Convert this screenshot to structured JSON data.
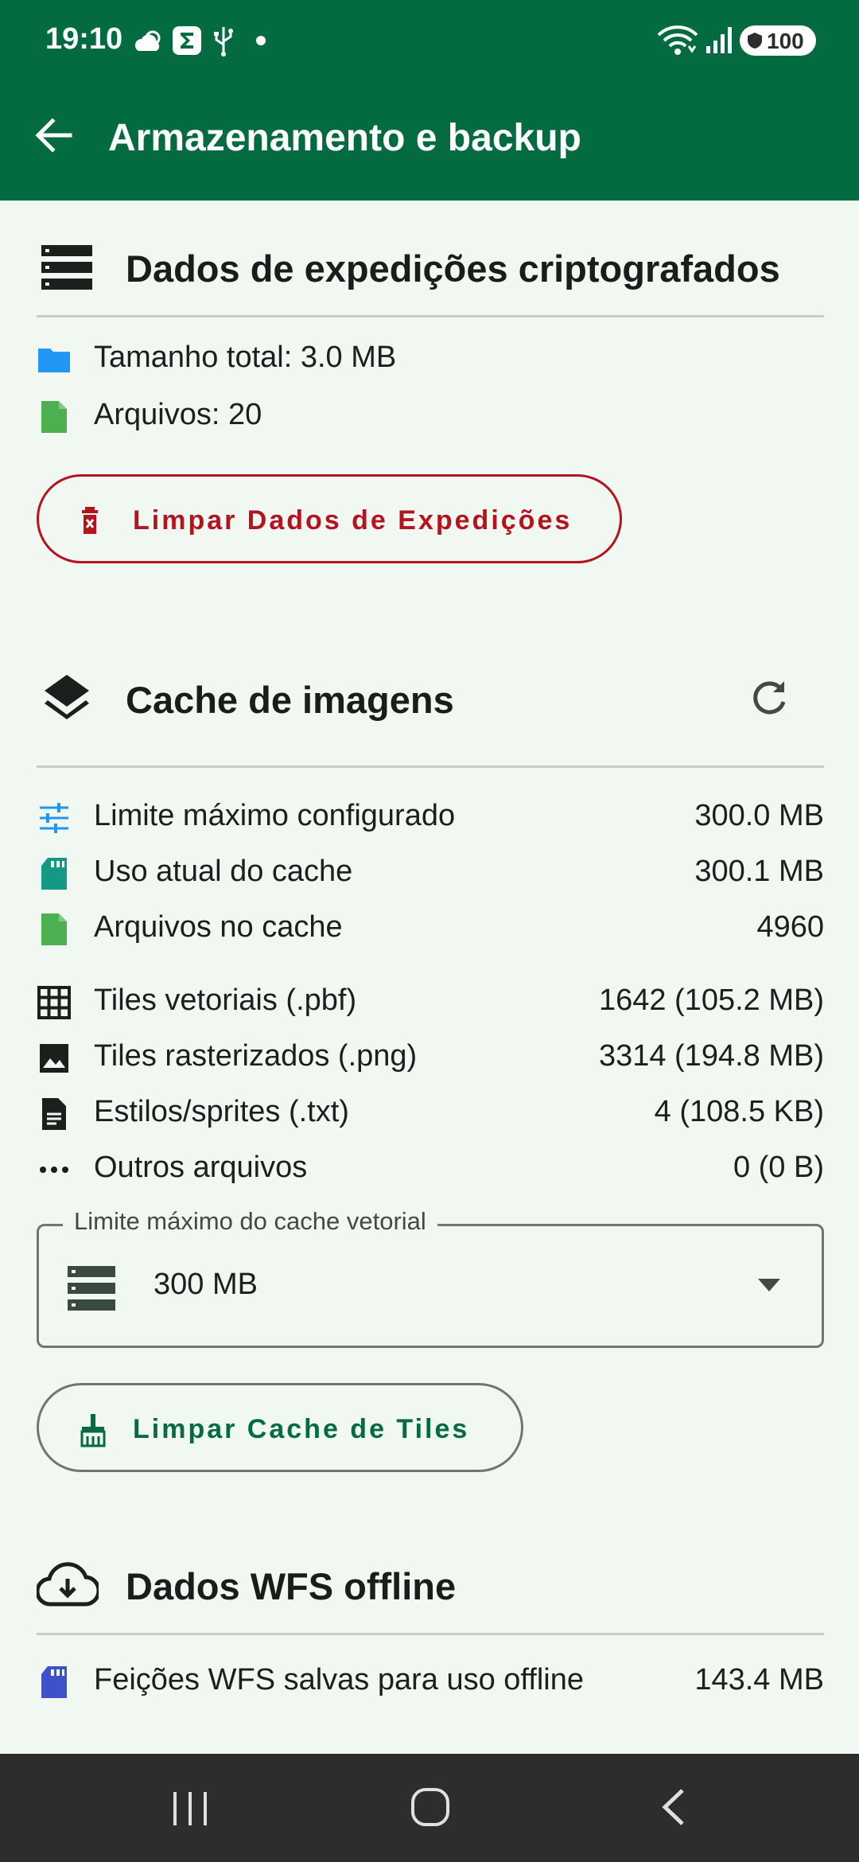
{
  "status_bar": {
    "time": "19:10",
    "battery": "100",
    "icons": [
      "weather-icon",
      "sigma-icon",
      "usb-icon",
      "dot-icon",
      "wifi-icon",
      "signal-icon",
      "battery-icon"
    ]
  },
  "app_bar": {
    "title": "Armazenamento e backup",
    "back_icon": "arrow-back-icon"
  },
  "expedition_section": {
    "title": "Dados de expedições criptografados",
    "icon": "storage-list-icon",
    "rows": [
      {
        "label": "Tamanho total: 3.0 MB",
        "icon": "folder-icon",
        "color": "#2196f3"
      },
      {
        "label": "Arquivos: 20",
        "icon": "file-icon",
        "color": "#4caf50"
      }
    ],
    "clear_button": "Limpar Dados de Expedições",
    "clear_color": "#b3141e"
  },
  "cache_section": {
    "title": "Cache de imagens",
    "icon": "layers-icon",
    "refresh_icon": "refresh-icon",
    "rows": [
      {
        "label": "Limite máximo configurado",
        "value": "300.0 MB",
        "icon": "tune-icon",
        "color": "#2196f3"
      },
      {
        "label": "Uso atual do cache",
        "value": "300.1 MB",
        "icon": "sd-card-icon",
        "color": "#149a84"
      },
      {
        "label": "Arquivos no cache",
        "value": "4960",
        "icon": "file-icon",
        "color": "#4caf50"
      },
      {
        "label": "Tiles vetoriais (.pbf)",
        "value": "1642 (105.2 MB)",
        "icon": "grid-icon",
        "color": "#1c1f1c"
      },
      {
        "label": "Tiles rasterizados (.png)",
        "value": "3314 (194.8 MB)",
        "icon": "image-icon",
        "color": "#1c1f1c"
      },
      {
        "label": "Estilos/sprites (.txt)",
        "value": "4 (108.5 KB)",
        "icon": "document-icon",
        "color": "#1c1f1c"
      },
      {
        "label": "Outros arquivos",
        "value": "0 (0 B)",
        "icon": "more-horiz-icon",
        "color": "#1c1f1c"
      }
    ],
    "dropdown": {
      "label": "Limite máximo do cache vetorial",
      "value": "300 MB",
      "icon": "storage-icon"
    },
    "clear_button": "Limpar Cache de Tiles",
    "clear_color": "#036b3f"
  },
  "wfs_section": {
    "title": "Dados WFS offline",
    "icon": "cloud-download-icon",
    "rows": [
      {
        "label": "Feições WFS salvas para uso offline",
        "value": "143.4 MB",
        "icon": "sd-card-icon",
        "color": "#3f51c8"
      }
    ]
  },
  "nav_bar": {
    "items": [
      "recents-icon",
      "home-icon",
      "back-icon"
    ]
  }
}
